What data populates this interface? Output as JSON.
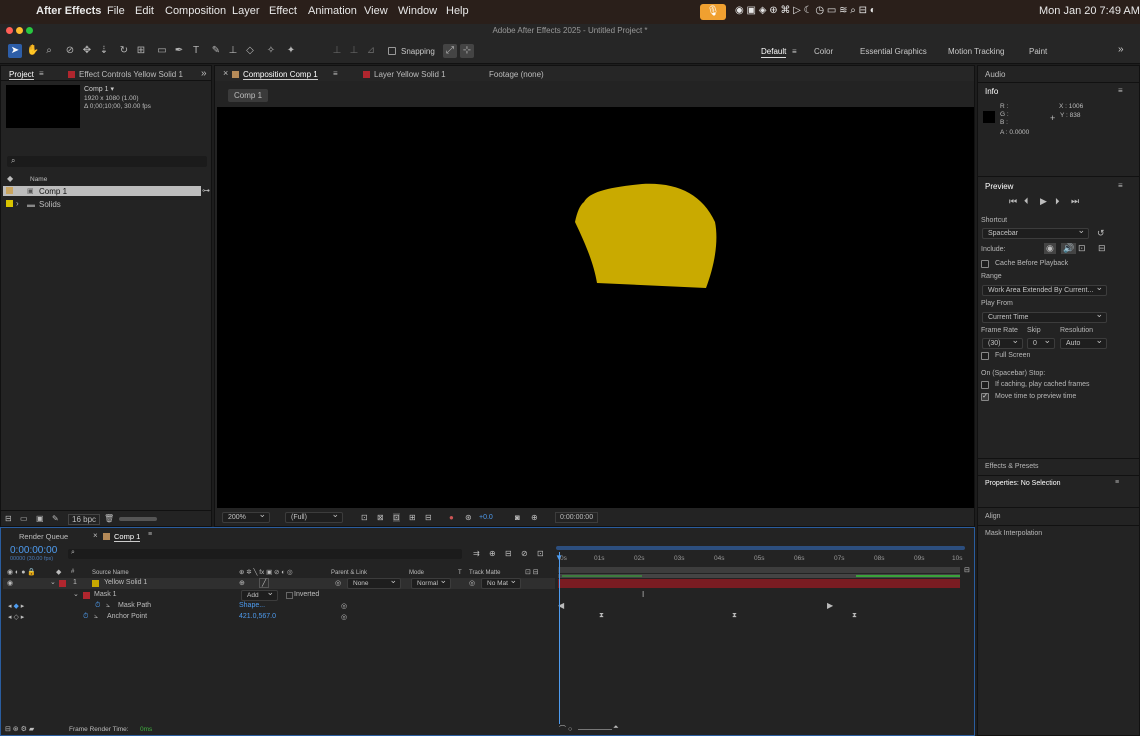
{
  "menubar": {
    "app": "After Effects",
    "items": [
      "File",
      "Edit",
      "Composition",
      "Layer",
      "Effect",
      "Animation",
      "View",
      "Window",
      "Help"
    ],
    "clock": "Mon Jan 20  7:49 AM"
  },
  "window": {
    "title": "Adobe After Effects 2025 - Untitled Project *"
  },
  "toolbar": {
    "snapping": "Snapping",
    "workspaces": [
      "Default",
      "Color",
      "Essential Graphics",
      "Motion Tracking",
      "Paint"
    ],
    "active_workspace": "Default"
  },
  "project": {
    "tab": "Project",
    "effect_tab": "Effect Controls Yellow Solid 1",
    "comp_name": "Comp 1 ▾",
    "comp_size": "1920 x 1080 (1.00)",
    "comp_duration": "Δ 0;00;10;00, 30.00 fps",
    "col_name": "Name",
    "items": [
      {
        "label": "Comp 1"
      },
      {
        "label": "Solids"
      }
    ],
    "bpc": "16 bpc"
  },
  "viewer": {
    "tab_comp": "Composition Comp 1",
    "tab_layer": "Layer Yellow Solid 1",
    "tab_footage": "Footage (none)",
    "crumb": "Comp 1",
    "zoom": "200%",
    "resolution": "(Full)",
    "exposure": "+0.0",
    "timecode": "0:00:00:00",
    "shape_color": "#c9aa00"
  },
  "right": {
    "audio": "Audio",
    "info": "Info",
    "info_r": "R :",
    "info_g": "G :",
    "info_b": "B :",
    "info_a": "A :  0.0000",
    "info_x": "X : 1006",
    "info_y": "Y :  838",
    "preview": "Preview",
    "shortcut_lbl": "Shortcut",
    "shortcut": "Spacebar",
    "include": "Include:",
    "cache": "Cache Before Playback",
    "range_lbl": "Range",
    "range": "Work Area Extended By Current...",
    "playfrom_lbl": "Play From",
    "playfrom": "Current Time",
    "fr_lbl": "Frame Rate",
    "skip_lbl": "Skip",
    "res_lbl": "Resolution",
    "fr": "(30)",
    "skip": "0",
    "res": "Auto",
    "fullscreen": "Full Screen",
    "onstop": "On (Spacebar) Stop:",
    "ifcaching": "If caching, play cached frames",
    "movetime": "Move time to preview time",
    "effects": "Effects & Presets",
    "props": "Properties: No Selection",
    "align": "Align",
    "maskinterp": "Mask Interpolation"
  },
  "timeline": {
    "render_queue": "Render Queue",
    "comp_tab": "Comp 1",
    "timecode": "0:00:00:00",
    "fps": "00000 (30.00 fps)",
    "cols": {
      "source": "Source Name",
      "parent": "Parent & Link",
      "mode": "Mode",
      "t": "T",
      "track": "Track Matte"
    },
    "layer": {
      "num": "1",
      "name": "Yellow Solid 1",
      "parent": "None",
      "mode": "Normal",
      "matte": "No Mat"
    },
    "mask": {
      "name": "Mask 1",
      "mode": "Add",
      "inverted": "Inverted"
    },
    "mask_path": {
      "name": "Mask Path",
      "value": "Shape..."
    },
    "anchor": {
      "name": "Anchor Point",
      "value": "421.0,567.0"
    },
    "ticks": [
      "0s",
      "01s",
      "02s",
      "03s",
      "04s",
      "05s",
      "06s",
      "07s",
      "08s",
      "09s",
      "10s"
    ],
    "frame_render": "Frame Render Time:",
    "frame_render_val": "0ms"
  }
}
